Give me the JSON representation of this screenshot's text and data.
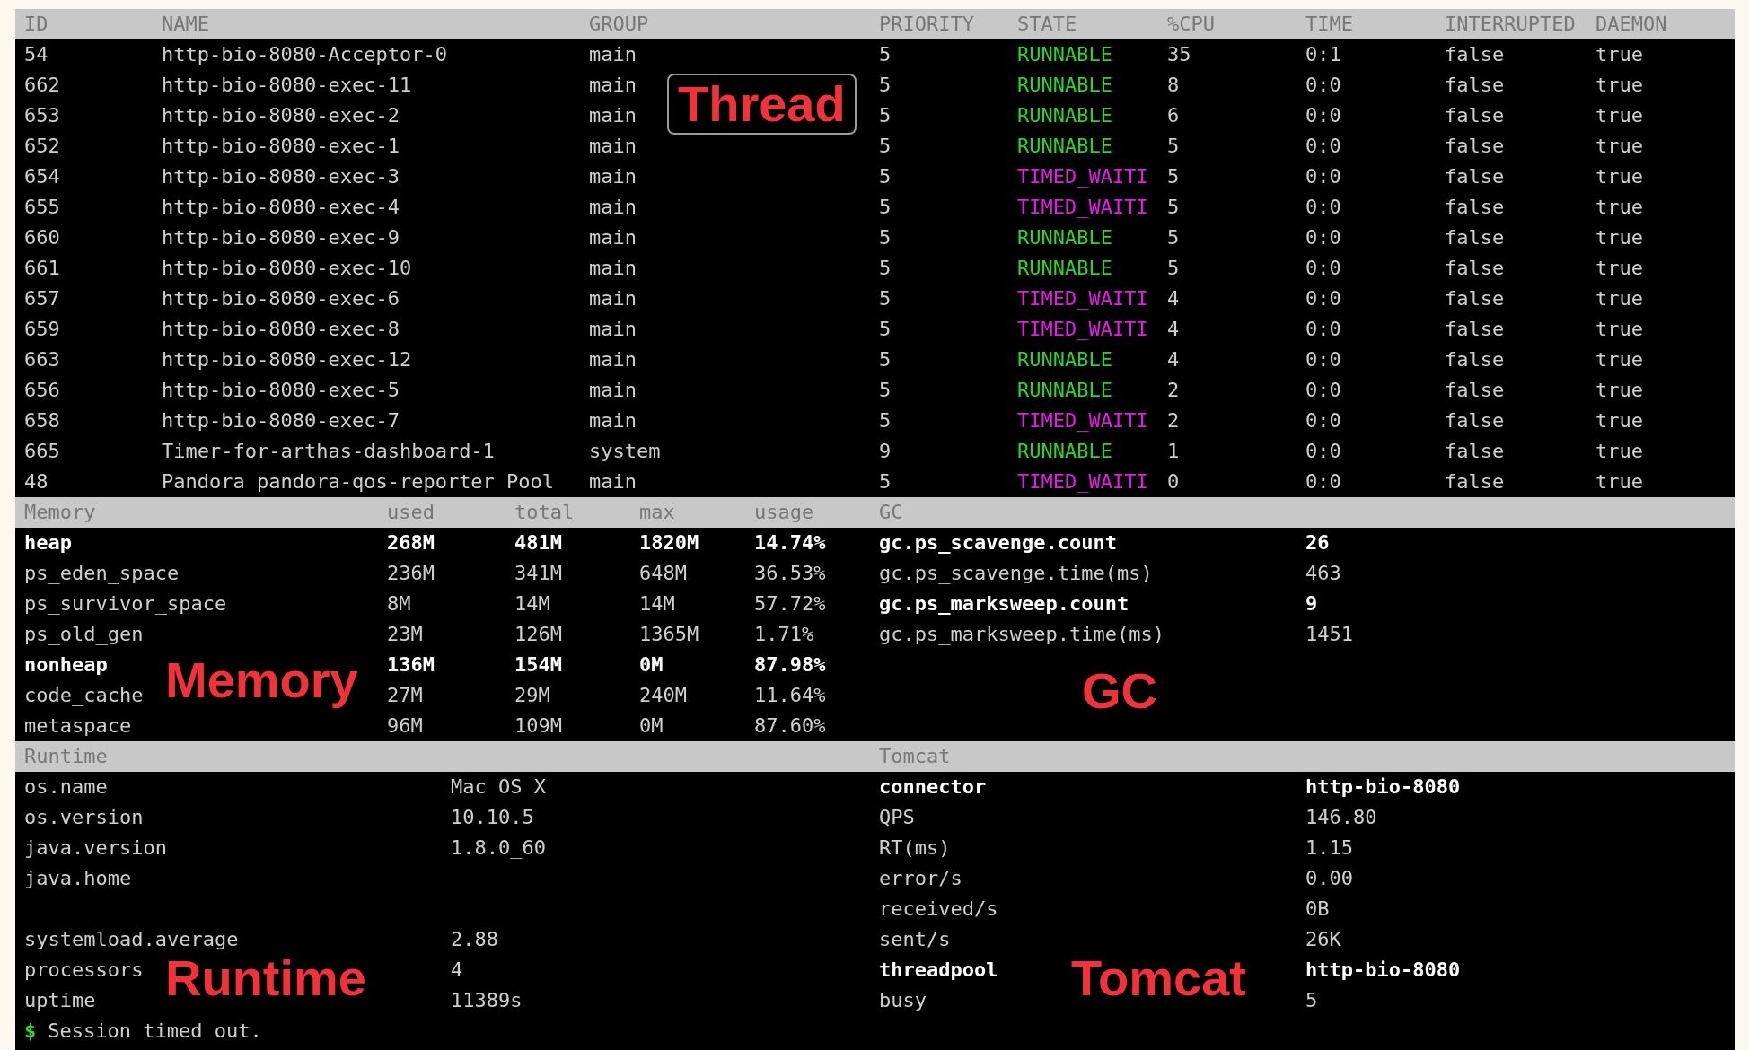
{
  "thread_table": {
    "columns": [
      "ID",
      "NAME",
      "GROUP",
      "PRIORITY",
      "STATE",
      "%CPU",
      "TIME",
      "INTERRUPTED",
      "DAEMON"
    ],
    "rows": [
      {
        "id": "54",
        "name": "http-bio-8080-Acceptor-0",
        "group": "main",
        "priority": "5",
        "state": {
          "text": "RUNNABLE",
          "color": "#2ed12e"
        },
        "cpu": "35",
        "time": "0:1",
        "interrupted": "false",
        "daemon": "true"
      },
      {
        "id": "662",
        "name": "http-bio-8080-exec-11",
        "group": "main",
        "priority": "5",
        "state": {
          "text": "RUNNABLE",
          "color": "#2ed12e"
        },
        "cpu": "8",
        "time": "0:0",
        "interrupted": "false",
        "daemon": "true"
      },
      {
        "id": "653",
        "name": "http-bio-8080-exec-2",
        "group": "main",
        "priority": "5",
        "state": {
          "text": "RUNNABLE",
          "color": "#2ed12e"
        },
        "cpu": "6",
        "time": "0:0",
        "interrupted": "false",
        "daemon": "true"
      },
      {
        "id": "652",
        "name": "http-bio-8080-exec-1",
        "group": "main",
        "priority": "5",
        "state": {
          "text": "RUNNABLE",
          "color": "#2ed12e"
        },
        "cpu": "5",
        "time": "0:0",
        "interrupted": "false",
        "daemon": "true"
      },
      {
        "id": "654",
        "name": "http-bio-8080-exec-3",
        "group": "main",
        "priority": "5",
        "state": {
          "text": "TIMED_WAITI",
          "color": "#e020e0"
        },
        "cpu": "5",
        "time": "0:0",
        "interrupted": "false",
        "daemon": "true"
      },
      {
        "id": "655",
        "name": "http-bio-8080-exec-4",
        "group": "main",
        "priority": "5",
        "state": {
          "text": "TIMED_WAITI",
          "color": "#e020e0"
        },
        "cpu": "5",
        "time": "0:0",
        "interrupted": "false",
        "daemon": "true"
      },
      {
        "id": "660",
        "name": "http-bio-8080-exec-9",
        "group": "main",
        "priority": "5",
        "state": {
          "text": "RUNNABLE",
          "color": "#2ed12e"
        },
        "cpu": "5",
        "time": "0:0",
        "interrupted": "false",
        "daemon": "true"
      },
      {
        "id": "661",
        "name": "http-bio-8080-exec-10",
        "group": "main",
        "priority": "5",
        "state": {
          "text": "RUNNABLE",
          "color": "#2ed12e"
        },
        "cpu": "5",
        "time": "0:0",
        "interrupted": "false",
        "daemon": "true"
      },
      {
        "id": "657",
        "name": "http-bio-8080-exec-6",
        "group": "main",
        "priority": "5",
        "state": {
          "text": "TIMED_WAITI",
          "color": "#e020e0"
        },
        "cpu": "4",
        "time": "0:0",
        "interrupted": "false",
        "daemon": "true"
      },
      {
        "id": "659",
        "name": "http-bio-8080-exec-8",
        "group": "main",
        "priority": "5",
        "state": {
          "text": "TIMED_WAITI",
          "color": "#e020e0"
        },
        "cpu": "4",
        "time": "0:0",
        "interrupted": "false",
        "daemon": "true"
      },
      {
        "id": "663",
        "name": "http-bio-8080-exec-12",
        "group": "main",
        "priority": "5",
        "state": {
          "text": "RUNNABLE",
          "color": "#2ed12e"
        },
        "cpu": "4",
        "time": "0:0",
        "interrupted": "false",
        "daemon": "true"
      },
      {
        "id": "656",
        "name": "http-bio-8080-exec-5",
        "group": "main",
        "priority": "5",
        "state": {
          "text": "RUNNABLE",
          "color": "#2ed12e"
        },
        "cpu": "2",
        "time": "0:0",
        "interrupted": "false",
        "daemon": "true"
      },
      {
        "id": "658",
        "name": "http-bio-8080-exec-7",
        "group": "main",
        "priority": "5",
        "state": {
          "text": "TIMED_WAITI",
          "color": "#e020e0"
        },
        "cpu": "2",
        "time": "0:0",
        "interrupted": "false",
        "daemon": "true"
      },
      {
        "id": "665",
        "name": "Timer-for-arthas-dashboard-1",
        "group": "system",
        "priority": "9",
        "state": {
          "text": "RUNNABLE",
          "color": "#2ed12e"
        },
        "cpu": "1",
        "time": "0:0",
        "interrupted": "false",
        "daemon": "true"
      },
      {
        "id": "48",
        "name": "Pandora pandora-qos-reporter Pool",
        "group": "main",
        "priority": "5",
        "state": {
          "text": "TIMED_WAITI",
          "color": "#e020e0"
        },
        "cpu": "0",
        "time": "0:0",
        "interrupted": "false",
        "daemon": "true"
      }
    ],
    "annotation": {
      "text": "Thread",
      "boxed": true
    }
  },
  "memory": {
    "columns": [
      "Memory",
      "used",
      "total",
      "max",
      "usage"
    ],
    "rows": [
      {
        "name": "heap",
        "used": "268M",
        "total": "481M",
        "max": "1820M",
        "usage": "14.74%",
        "bold": true
      },
      {
        "name": "ps_eden_space",
        "used": "236M",
        "total": "341M",
        "max": "648M",
        "usage": "36.53%",
        "bold": false
      },
      {
        "name": "ps_survivor_space",
        "used": "8M",
        "total": "14M",
        "max": "14M",
        "usage": "57.72%",
        "bold": false
      },
      {
        "name": "ps_old_gen",
        "used": "23M",
        "total": "126M",
        "max": "1365M",
        "usage": "1.71%",
        "bold": false
      },
      {
        "name": "nonheap",
        "used": "136M",
        "total": "154M",
        "max": "0M",
        "usage": "87.98%",
        "bold": true
      },
      {
        "name": "code_cache",
        "used": "27M",
        "total": "29M",
        "max": "240M",
        "usage": "11.64%",
        "bold": false
      },
      {
        "name": "metaspace",
        "used": "96M",
        "total": "109M",
        "max": "0M",
        "usage": "87.60%",
        "bold": false
      }
    ],
    "annotation": {
      "text": "Memory",
      "boxed": false
    }
  },
  "gc": {
    "title": "GC",
    "rows": [
      {
        "key": "gc.ps_scavenge.count",
        "value": "26",
        "bold": true
      },
      {
        "key": "gc.ps_scavenge.time(ms)",
        "value": "463",
        "bold": false
      },
      {
        "key": "gc.ps_marksweep.count",
        "value": "9",
        "bold": true
      },
      {
        "key": "gc.ps_marksweep.time(ms)",
        "value": "1451",
        "bold": false
      }
    ],
    "annotation": {
      "text": "GC",
      "boxed": false
    }
  },
  "runtime": {
    "title": "Runtime",
    "rows": [
      {
        "key": "os.name",
        "value": "Mac OS X"
      },
      {
        "key": "os.version",
        "value": "10.10.5"
      },
      {
        "key": "java.version",
        "value": "1.8.0_60"
      },
      {
        "key": "java.home"
      },
      {
        "key": "systemload.average",
        "value": "2.88"
      },
      {
        "key": "processors",
        "value": "4"
      },
      {
        "key": "uptime",
        "value": "11389s"
      }
    ],
    "annotation": {
      "text": "Runtime",
      "boxed": false
    }
  },
  "tomcat": {
    "title": "Tomcat",
    "rows": [
      {
        "key": "connector",
        "value": "http-bio-8080",
        "bold": true
      },
      {
        "key": "QPS",
        "value": "146.80",
        "bold": false
      },
      {
        "key": "RT(ms)",
        "value": "1.15",
        "bold": false
      },
      {
        "key": "error/s",
        "value": "0.00",
        "bold": false
      },
      {
        "key": "received/s",
        "value": "0B",
        "bold": false
      },
      {
        "key": "sent/s",
        "value": "26K",
        "bold": false
      },
      {
        "key": "threadpool",
        "value": "http-bio-8080",
        "bold": true
      },
      {
        "key": "busy",
        "value": "5",
        "bold": false
      }
    ],
    "annotation": {
      "text": "Tomcat",
      "boxed": false
    }
  },
  "prompt": {
    "symbol": "$",
    "text": "Session timed out."
  }
}
